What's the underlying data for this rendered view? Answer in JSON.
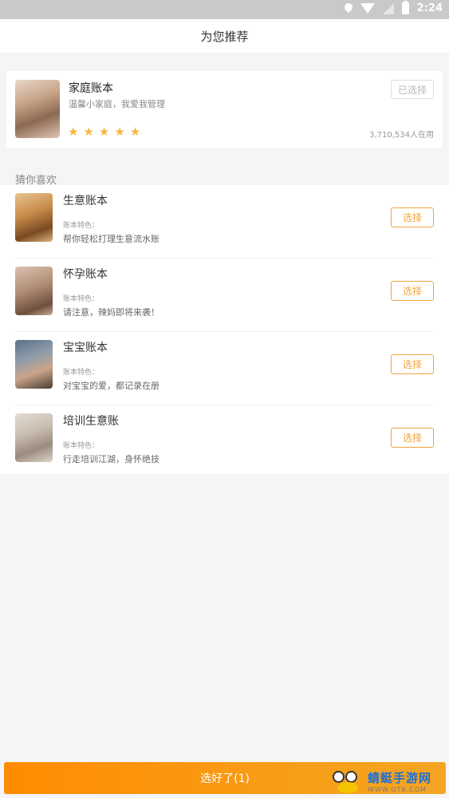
{
  "status_bar": {
    "time": "2:24"
  },
  "header": {
    "title": "为您推荐"
  },
  "recommended": {
    "title": "家庭账本",
    "subtitle": "温馨小家庭，我爱我管理",
    "selected_label": "已选择",
    "users": "3,710,534人在用",
    "rating": 5
  },
  "section": {
    "label": "猜你喜欢"
  },
  "items": [
    {
      "title": "生意账本",
      "feature_label": "账本特色：",
      "desc": "帮你轻松打理生意流水账",
      "button": "选择"
    },
    {
      "title": "怀孕账本",
      "feature_label": "账本特色：",
      "desc": "请注意，辣妈即将来袭！",
      "button": "选择"
    },
    {
      "title": "宝宝账本",
      "feature_label": "账本特色：",
      "desc": "对宝宝的爱，都记录在册",
      "button": "选择"
    },
    {
      "title": "培训生意账",
      "feature_label": "账本特色：",
      "desc": "行走培训江湖，身怀绝技",
      "button": "选择"
    }
  ],
  "footer": {
    "confirm_label": "选好了(1)"
  },
  "watermark": {
    "title": "蜻蜓手游网",
    "url": "WWW.QT6.COM"
  },
  "colors": {
    "accent": "#f0a33e",
    "star": "#f5b83d",
    "confirm_start": "#ff8c00",
    "confirm_end": "#f4a623"
  }
}
